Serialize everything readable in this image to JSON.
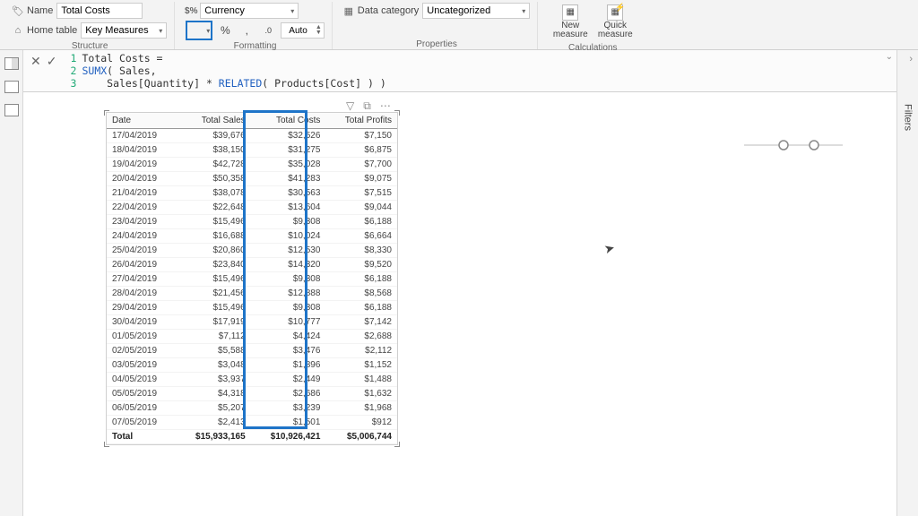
{
  "ribbon": {
    "name_label": "Name",
    "name_value": "Total Costs",
    "home_table_label": "Home table",
    "home_table_value": "Key Measures",
    "format_dropdown": "Currency",
    "percent_btn": "%",
    "comma_btn": ",",
    "decimal_inc": ".0",
    "auto_label": "Auto",
    "data_category_label": "Data category",
    "data_category_value": "Uncategorized",
    "new_measure": "New measure",
    "quick_measure": "Quick measure",
    "structure_caption": "Structure",
    "formatting_caption": "Formatting",
    "properties_caption": "Properties",
    "calculations_caption": "Calculations"
  },
  "formula": {
    "line1": "Total Costs =",
    "line2a": "SUMX",
    "line2b": "( Sales,",
    "line3a": "    Sales[Quantity] * ",
    "line3b": "RELATED",
    "line3c": "( Products[Cost] ) )"
  },
  "table": {
    "headers": [
      "Date",
      "Total Sales",
      "Total Costs",
      "Total Profits"
    ],
    "rows": [
      [
        "17/04/2019",
        "$39,676",
        "$32,526",
        "$7,150"
      ],
      [
        "18/04/2019",
        "$38,150",
        "$31,275",
        "$6,875"
      ],
      [
        "19/04/2019",
        "$42,728",
        "$35,028",
        "$7,700"
      ],
      [
        "20/04/2019",
        "$50,358",
        "$41,283",
        "$9,075"
      ],
      [
        "21/04/2019",
        "$38,078",
        "$30,563",
        "$7,515"
      ],
      [
        "22/04/2019",
        "$22,648",
        "$13,604",
        "$9,044"
      ],
      [
        "23/04/2019",
        "$15,496",
        "$9,308",
        "$6,188"
      ],
      [
        "24/04/2019",
        "$16,688",
        "$10,024",
        "$6,664"
      ],
      [
        "25/04/2019",
        "$20,860",
        "$12,530",
        "$8,330"
      ],
      [
        "26/04/2019",
        "$23,840",
        "$14,320",
        "$9,520"
      ],
      [
        "27/04/2019",
        "$15,496",
        "$9,308",
        "$6,188"
      ],
      [
        "28/04/2019",
        "$21,456",
        "$12,888",
        "$8,568"
      ],
      [
        "29/04/2019",
        "$15,496",
        "$9,308",
        "$6,188"
      ],
      [
        "30/04/2019",
        "$17,919",
        "$10,777",
        "$7,142"
      ],
      [
        "01/05/2019",
        "$7,112",
        "$4,424",
        "$2,688"
      ],
      [
        "02/05/2019",
        "$5,588",
        "$3,476",
        "$2,112"
      ],
      [
        "03/05/2019",
        "$3,048",
        "$1,896",
        "$1,152"
      ],
      [
        "04/05/2019",
        "$3,937",
        "$2,449",
        "$1,488"
      ],
      [
        "05/05/2019",
        "$4,318",
        "$2,686",
        "$1,632"
      ],
      [
        "06/05/2019",
        "$5,207",
        "$3,239",
        "$1,968"
      ],
      [
        "07/05/2019",
        "$2,413",
        "$1,501",
        "$912"
      ]
    ],
    "total_row": [
      "Total",
      "$15,933,165",
      "$10,926,421",
      "$5,006,744"
    ]
  },
  "filters_label": "Filters",
  "currency_symbol": "$"
}
